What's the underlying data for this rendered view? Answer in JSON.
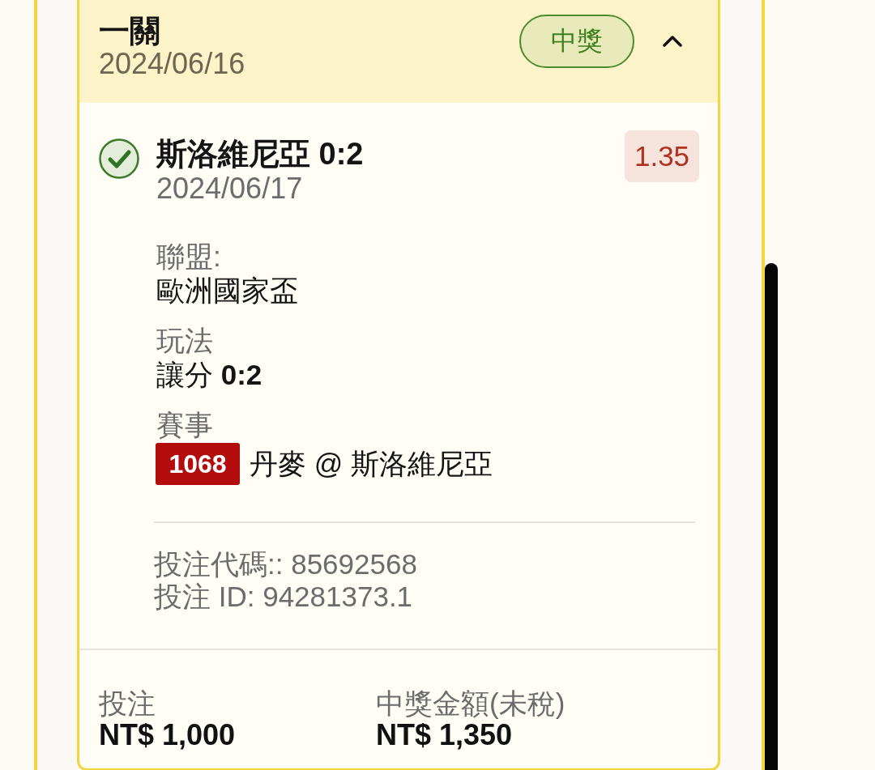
{
  "bet": {
    "header": {
      "title": "一關",
      "date": "2024/06/16",
      "status": "中獎",
      "expanded": true
    },
    "selection": {
      "won": true,
      "title": "斯洛維尼亞 0:2",
      "date": "2024/06/17",
      "odds": "1.35",
      "details": [
        {
          "kind": "text",
          "label": "聯盟:",
          "value": "歐洲國家盃"
        },
        {
          "kind": "text",
          "label": "玩法",
          "value": "讓分 **0:2**"
        },
        {
          "kind": "match",
          "label": "賽事",
          "match_number": "1068",
          "value": "丹麥 @ 斯洛維尼亞"
        }
      ],
      "references": [
        "投注代碼:: 85692568",
        "投注 ID: 94281373.1"
      ]
    },
    "summary": [
      {
        "label": "投注",
        "amount": "NT$ 1,000"
      },
      {
        "label": "中獎金額(未稅)",
        "amount": "NT$ 1,350"
      }
    ]
  }
}
